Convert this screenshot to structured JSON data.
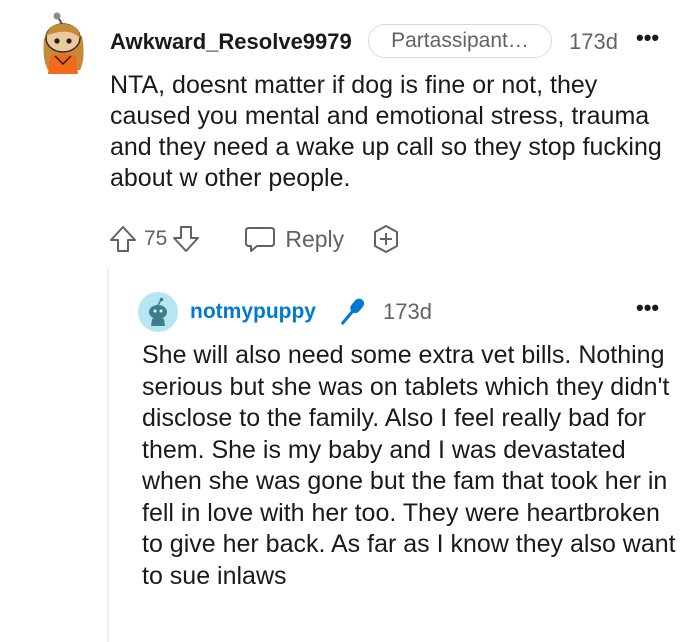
{
  "comment": {
    "author": "Awkward_Resolve9979",
    "flair": "Partassipant…",
    "age": "173d",
    "more": "•••",
    "text": "NTA, doesnt matter if dog is fine or not, they caused you mental and emotional stress, trauma and they need a wake up call so they stop fucking about w other people.",
    "score": "75",
    "reply_label": "Reply"
  },
  "reply": {
    "author": "notmypuppy",
    "age": "173d",
    "more": "•••",
    "text": "She will also need some extra vet bills. Nothing serious but she was on tablets which they didn't disclose to the family. Also I feel really bad for them. She is my baby and I was devastated when she was gone but the fam that took her in fell in love with her too. They were heartbroken to give her back. As far as I know they also want to sue inlaws"
  },
  "icons": {
    "upvote": "arrow-up-icon",
    "downvote": "arrow-down-icon",
    "reply": "chat-bubble-icon",
    "award": "award-plus-icon",
    "op_badge": "microphone-icon",
    "more": "more-dots-icon"
  },
  "colors": {
    "username_reply": "#0079d3",
    "meta_grey": "#5f6368",
    "text": "#1a1a1b",
    "mic": "#0079d3"
  }
}
